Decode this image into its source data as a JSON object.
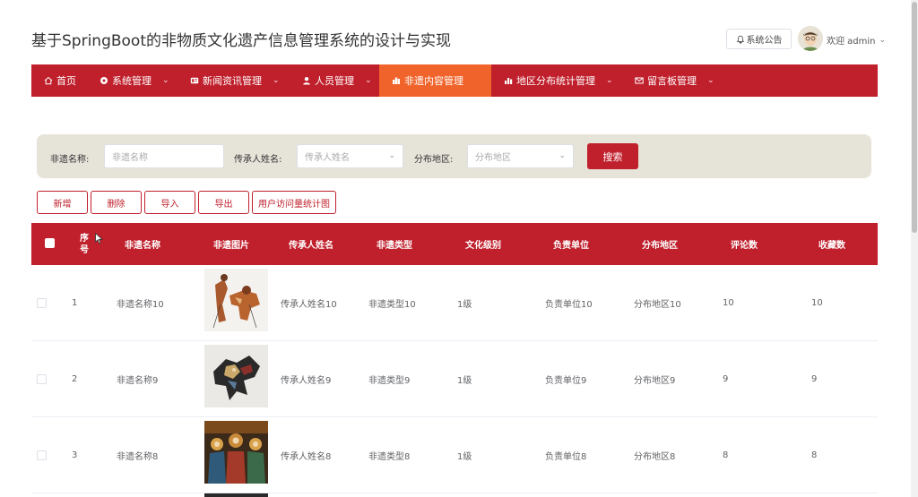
{
  "header": {
    "title": "基于SpringBoot的非物质文化遗产信息管理系统的设计与实现",
    "notice_label": "系统公告",
    "welcome": "欢迎 admin"
  },
  "nav": [
    {
      "label": "首页",
      "icon": "home-icon",
      "caret": false,
      "active": false
    },
    {
      "label": "系统管理",
      "icon": "gear-icon",
      "caret": true,
      "active": false
    },
    {
      "label": "新闻资讯管理",
      "icon": "news-icon",
      "caret": true,
      "active": false
    },
    {
      "label": "人员管理",
      "icon": "user-icon",
      "caret": true,
      "active": false
    },
    {
      "label": "非遗内容管理",
      "icon": "building-icon",
      "caret": true,
      "active": true
    },
    {
      "label": "地区分布统计管理",
      "icon": "chart-icon",
      "caret": true,
      "active": false
    },
    {
      "label": "留言板管理",
      "icon": "mail-icon",
      "caret": true,
      "active": false
    }
  ],
  "search": {
    "name_label": "非遗名称:",
    "name_placeholder": "非遗名称",
    "inheritor_label": "传承人姓名:",
    "inheritor_placeholder": "传承人姓名",
    "region_label": "分布地区:",
    "region_placeholder": "分布地区",
    "button": "搜索"
  },
  "actions": [
    "新增",
    "删除",
    "导入",
    "导出",
    "用户访问量统计图"
  ],
  "table": {
    "columns": [
      "序号",
      "非遗名称",
      "非遗图片",
      "传承人姓名",
      "非遗类型",
      "文化级别",
      "负责单位",
      "分布地区",
      "评论数",
      "收藏数"
    ],
    "rows": [
      {
        "index": "1",
        "name": "非遗名称10",
        "inheritor": "传承人姓名10",
        "type": "非遗类型10",
        "level": "1级",
        "unit": "负责单位10",
        "region": "分布地区10",
        "comments": "10",
        "favorites": "10"
      },
      {
        "index": "2",
        "name": "非遗名称9",
        "inheritor": "传承人姓名9",
        "type": "非遗类型9",
        "level": "1级",
        "unit": "负责单位9",
        "region": "分布地区9",
        "comments": "9",
        "favorites": "9"
      },
      {
        "index": "3",
        "name": "非遗名称8",
        "inheritor": "传承人姓名8",
        "type": "非遗类型8",
        "level": "1级",
        "unit": "负责单位8",
        "region": "分布地区8",
        "comments": "8",
        "favorites": "8"
      }
    ]
  },
  "colors": {
    "primary": "#c0202c",
    "active": "#f0632a",
    "panel": "#e6e3d9"
  }
}
